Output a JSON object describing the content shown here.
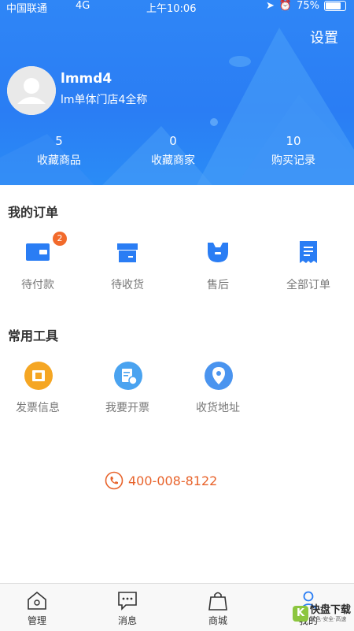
{
  "status_bar": {
    "carrier": "中国联通",
    "network": "4G",
    "time": "上午10:06",
    "battery": "75%"
  },
  "header": {
    "settings_label": "设置",
    "username": "lmmd4",
    "store_name": "lm单体门店4全称"
  },
  "stats": [
    {
      "value": "5",
      "label": "收藏商品"
    },
    {
      "value": "0",
      "label": "收藏商家"
    },
    {
      "value": "10",
      "label": "购买记录"
    }
  ],
  "orders": {
    "title": "我的订单",
    "items": [
      {
        "label": "待付款",
        "badge": "2",
        "icon": "wallet-icon"
      },
      {
        "label": "待收货",
        "icon": "package-icon"
      },
      {
        "label": "售后",
        "icon": "wrench-icon"
      },
      {
        "label": "全部订单",
        "icon": "receipt-icon"
      }
    ]
  },
  "tools": {
    "title": "常用工具",
    "items": [
      {
        "label": "发票信息",
        "icon": "ticket-icon",
        "color": "#f5a623"
      },
      {
        "label": "我要开票",
        "icon": "invoice-icon",
        "color": "#4aa3f0"
      },
      {
        "label": "收货地址",
        "icon": "location-icon",
        "color": "#4a94ef"
      }
    ]
  },
  "phone": "400-008-8122",
  "tabbar": [
    {
      "label": "管理",
      "icon": "home-icon"
    },
    {
      "label": "消息",
      "icon": "message-icon"
    },
    {
      "label": "商城",
      "icon": "shopping-bag-icon"
    },
    {
      "label": "我的",
      "icon": "user-icon",
      "active": true
    }
  ],
  "watermark": {
    "main": "快盘下载",
    "sub": "绿色·安全·高速"
  },
  "colors": {
    "primary": "#2a7df4",
    "accent": "#f26a2b",
    "icon_blue": "#2a7df4"
  }
}
